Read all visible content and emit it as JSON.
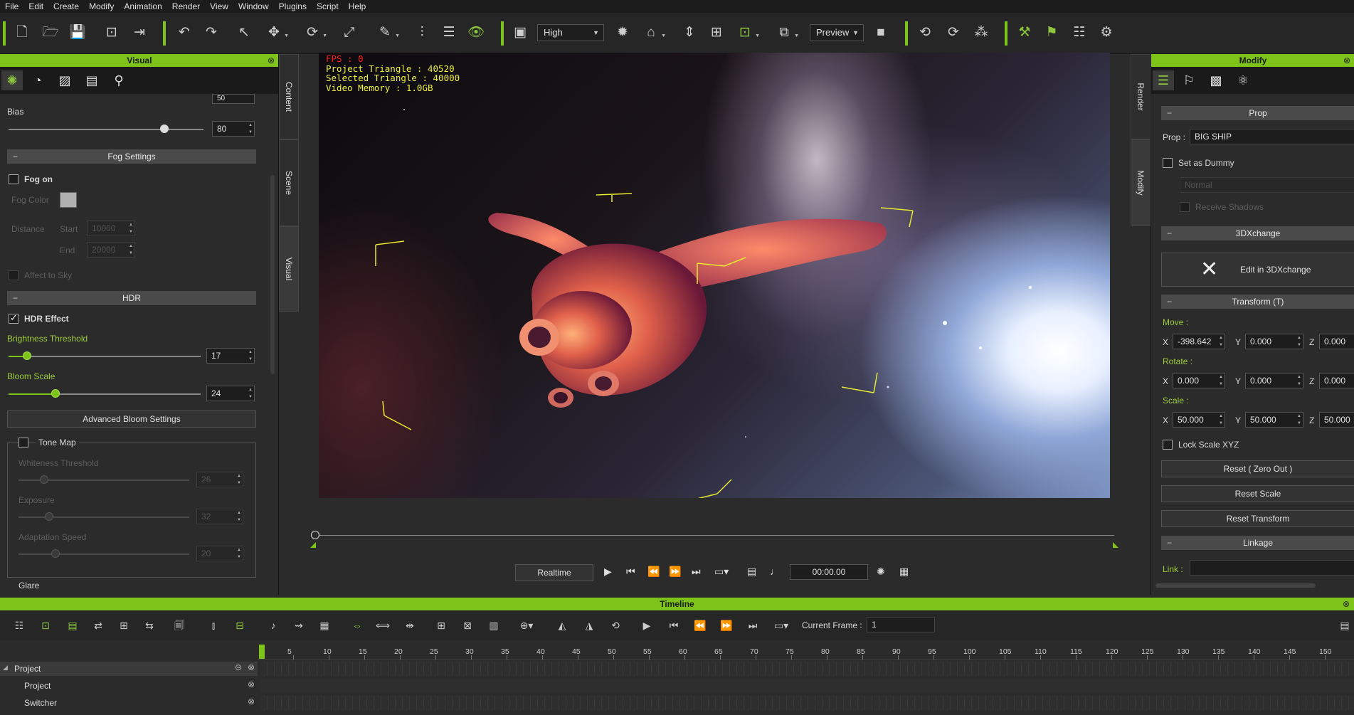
{
  "menu": [
    "File",
    "Edit",
    "Create",
    "Modify",
    "Animation",
    "Render",
    "View",
    "Window",
    "Plugins",
    "Script",
    "Help"
  ],
  "toolbar": {
    "quality_value": "High",
    "preview_value": "Preview"
  },
  "left_panel": {
    "title": "Visual",
    "top_spin_value": "50",
    "bias_label": "Bias",
    "bias_value": "80",
    "bias_fraction": 0.8,
    "fog_section": "Fog Settings",
    "fog_on_label": "Fog on",
    "fog_color_label": "Fog Color",
    "distance_label": "Distance",
    "start_label": "Start",
    "start_value": "10000",
    "end_label": "End",
    "end_value": "20000",
    "affect_sky_label": "Affect to Sky",
    "hdr_section": "HDR",
    "hdr_effect_label": "HDR Effect",
    "brightness_label": "Brightness Threshold",
    "brightness_value": "17",
    "brightness_fraction": 0.1,
    "bloom_label": "Bloom Scale",
    "bloom_value": "24",
    "bloom_fraction": 0.25,
    "adv_bloom_button": "Advanced Bloom Settings",
    "tone_map_label": "Tone Map",
    "whiteness_label": "Whiteness Threshold",
    "whiteness_value": "26",
    "exposure_label": "Exposure",
    "exposure_value": "32",
    "adaptation_label": "Adaptation Speed",
    "adaptation_value": "20",
    "glare_label": "Glare"
  },
  "side_tabs_left": [
    "Content",
    "Scene",
    "Visual"
  ],
  "side_tabs_right": [
    "Render",
    "Modify"
  ],
  "viewport": {
    "fps": "FPS : 0",
    "project_triangle": "Project Triangle : 40520",
    "selected_triangle": "Selected Triangle : 40000",
    "video_memory": "Video Memory : 1.0GB"
  },
  "playback": {
    "realtime_button": "Realtime",
    "time_value": "00:00.00"
  },
  "right_panel": {
    "title": "Modify",
    "prop_section": "Prop",
    "prop_label": "Prop :",
    "prop_value": "BIG SHIP",
    "set_dummy_label": "Set as Dummy",
    "normal_value": "Normal",
    "receive_shadows_label": "Receive Shadows",
    "xchange_section": "3DXchange",
    "edit_xchange_button": "Edit in 3DXchange",
    "transform_section": "Transform  (T)",
    "move_label": "Move :",
    "move": {
      "x": "-398.642",
      "y": "0.000",
      "z": "0.000"
    },
    "rotate_label": "Rotate :",
    "rotate": {
      "x": "0.000",
      "y": "0.000",
      "z": "0.000"
    },
    "scale_label": "Scale :",
    "scale": {
      "x": "50.000",
      "y": "50.000",
      "z": "50.000"
    },
    "axis_x": "X",
    "axis_y": "Y",
    "axis_z": "Z",
    "lock_scale_label": "Lock Scale XYZ",
    "reset_zero_button": "Reset ( Zero Out )",
    "reset_scale_button": "Reset Scale",
    "reset_transform_button": "Reset Transform",
    "linkage_section": "Linkage",
    "link_label": "Link :"
  },
  "timeline": {
    "title": "Timeline",
    "current_frame_label": "Current Frame :",
    "current_frame_value": "1",
    "ruler_labels": [
      "5",
      "10",
      "15",
      "20",
      "25",
      "30",
      "35",
      "40",
      "45",
      "50",
      "55",
      "60",
      "65",
      "70",
      "75",
      "80",
      "85",
      "90",
      "95",
      "100",
      "105",
      "110",
      "115",
      "120",
      "125",
      "130",
      "135",
      "140",
      "145",
      "150"
    ],
    "tracks": [
      "Project",
      "Project",
      "Switcher"
    ]
  },
  "colors": {
    "accent": "#7ec31a",
    "panel_bg": "#2b2b2b"
  }
}
